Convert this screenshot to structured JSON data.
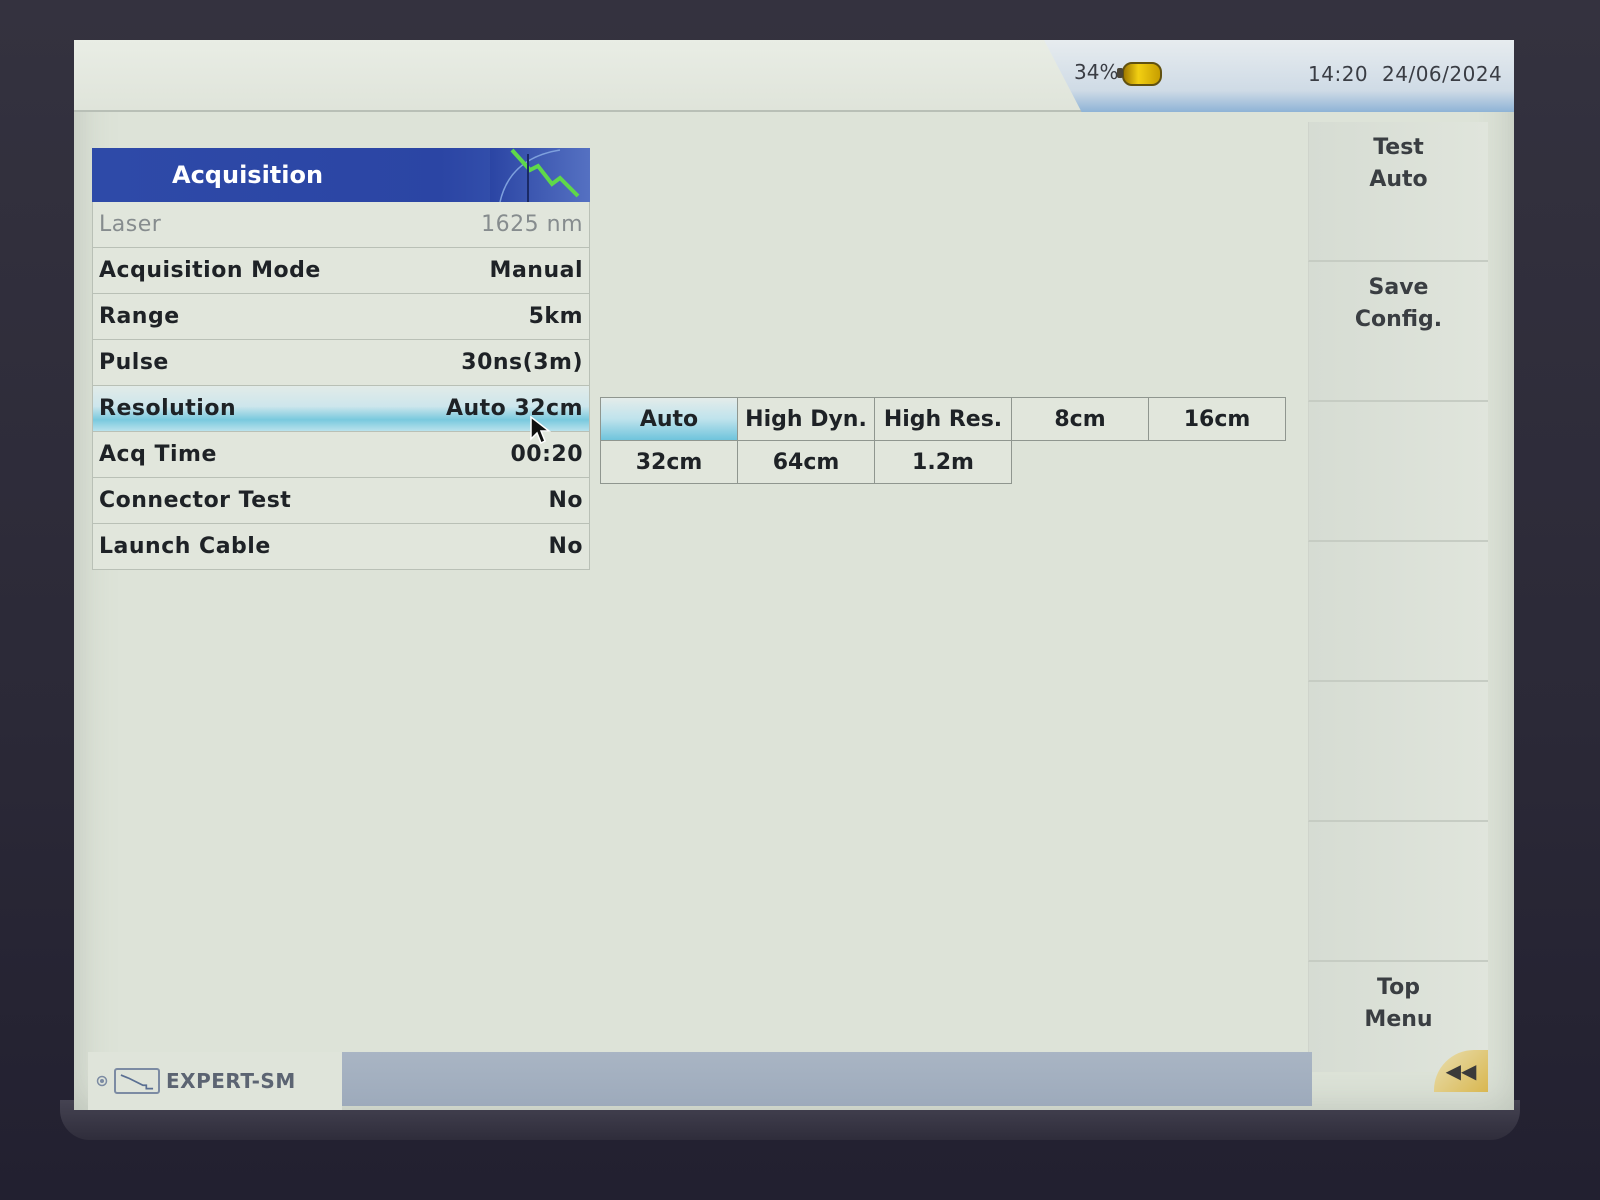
{
  "status": {
    "battery_pct": "34%",
    "time": "14:20",
    "date": "24/06/2024"
  },
  "panel": {
    "title": "Acquisition",
    "rows": [
      {
        "label": "Laser",
        "value": "1625 nm"
      },
      {
        "label": "Acquisition Mode",
        "value": "Manual"
      },
      {
        "label": "Range",
        "value": "5km"
      },
      {
        "label": "Pulse",
        "value": "30ns(3m)"
      },
      {
        "label": "Resolution",
        "value": "Auto 32cm"
      },
      {
        "label": "Acq Time",
        "value": "00:20"
      },
      {
        "label": "Connector Test",
        "value": "No"
      },
      {
        "label": "Launch Cable",
        "value": "No"
      }
    ]
  },
  "resolution_options": {
    "row1": [
      "Auto",
      "High Dyn.",
      "High Res.",
      "8cm",
      "16cm"
    ],
    "row2": [
      "32cm",
      "64cm",
      "1.2m"
    ],
    "selected": "Auto"
  },
  "softkeys": {
    "k1_line1": "Test",
    "k1_line2": "Auto",
    "k2_line1": "Save",
    "k2_line2": "Config.",
    "k7_line1": "Top",
    "k7_line2": "Menu"
  },
  "bottom": {
    "app_name": "EXPERT-SM"
  },
  "colors": {
    "header_blue": "#2e4aa8",
    "selection_cyan": "#79c9de",
    "battery_yellow": "#f2cf12"
  },
  "icons": {
    "battery": "battery-icon",
    "trace": "trace-graph-icon",
    "app": "otdr-trace-icon",
    "back": "double-chevron-left-icon",
    "pointer": "mouse-cursor-icon"
  }
}
